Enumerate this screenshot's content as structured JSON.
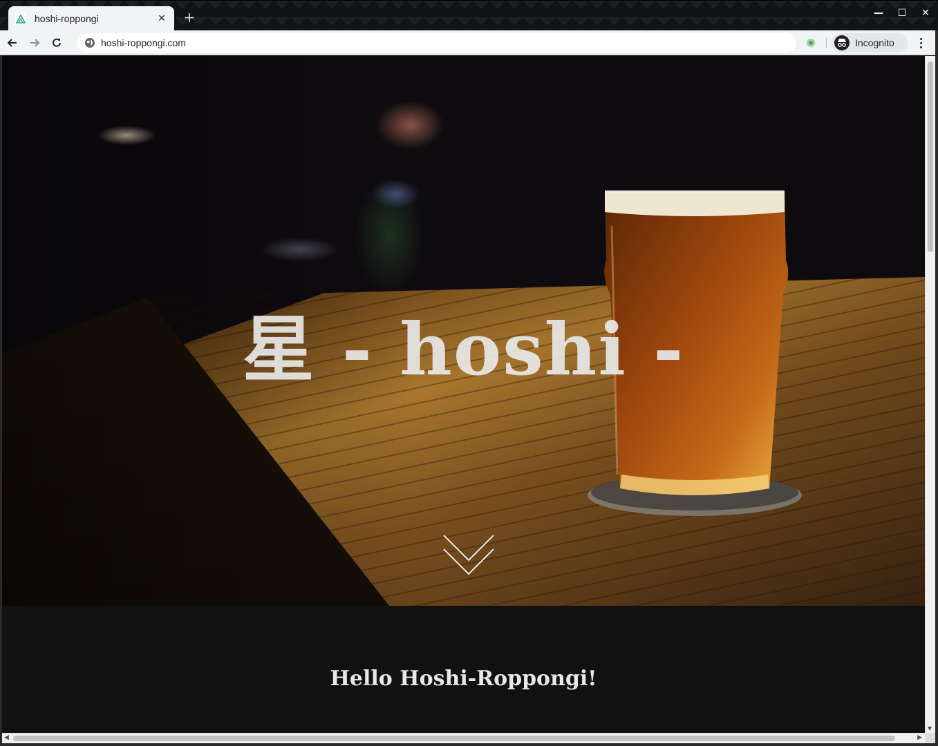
{
  "browser": {
    "tab_title": "hoshi-roppongi",
    "tab_close": "✕",
    "new_tab": "+",
    "url": "hoshi-roppongi.com",
    "incognito_label": "Incognito",
    "window_controls": {
      "minimize": "—",
      "maximize": "☐",
      "close": "✕"
    }
  },
  "hero": {
    "title": "星 - hoshi -"
  },
  "content": {
    "greeting": "Hello Hoshi-Roppongi!"
  },
  "colors": {
    "page_background": "#111111",
    "chrome_toolbar": "#f2f3f4",
    "title_text": "#e8e8e8"
  },
  "icons": [
    "favicon-icon",
    "close-icon",
    "plus-icon",
    "back-arrow-icon",
    "forward-arrow-icon",
    "reload-icon",
    "globe-icon",
    "extension-icon",
    "incognito-icon",
    "kebab-menu-icon",
    "chevron-down-icon"
  ]
}
